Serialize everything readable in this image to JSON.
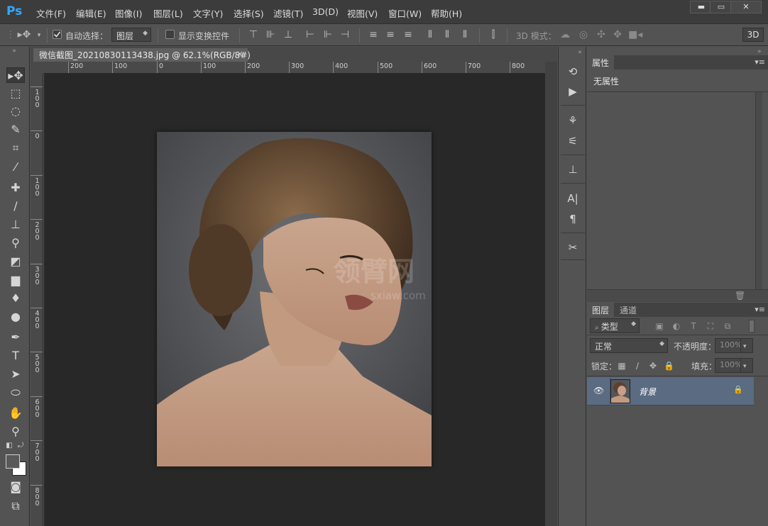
{
  "app": {
    "logo": "Ps"
  },
  "menu": [
    "文件(F)",
    "编辑(E)",
    "图像(I)",
    "图层(L)",
    "文字(Y)",
    "选择(S)",
    "滤镜(T)",
    "3D(D)",
    "视图(V)",
    "窗口(W)",
    "帮助(H)"
  ],
  "window_controls": {
    "minimize": "▬",
    "restore": "▭",
    "close": "✕"
  },
  "options": {
    "auto_select_label": "自动选择：",
    "auto_select_checked": true,
    "auto_select_target": "图层",
    "show_transform_label": "显示变换控件",
    "show_transform_checked": false,
    "mode_3d_label": "3D 模式：",
    "btn_3d": "3D"
  },
  "document": {
    "tab_title": "微信截图_20210830113438.jpg @ 62.1%(RGB/8#)",
    "tab_close": "×",
    "ruler_h_labels": [
      "200",
      "100",
      "0",
      "100",
      "200",
      "300",
      "400",
      "500",
      "600",
      "700",
      "800"
    ],
    "ruler_v_labels": [
      "100",
      "0",
      "100",
      "200",
      "300",
      "400",
      "500",
      "600",
      "700",
      "800"
    ],
    "watermark": "领臂网",
    "watermark_sub": "sxiaw.com"
  },
  "properties_panel": {
    "tab": "属性",
    "content": "无属性"
  },
  "layers_panel": {
    "tabs": [
      "图层",
      "通道"
    ],
    "filter_label": "类型",
    "blend_mode": "正常",
    "opacity_label": "不透明度：",
    "opacity_value": "100%",
    "lock_label": "锁定：",
    "fill_label": "填充：",
    "fill_value": "100%",
    "layers": [
      {
        "name": "背景",
        "visible": true,
        "locked": true
      }
    ]
  },
  "colors": {
    "menubar": "#3c3c3c",
    "panel": "#535353",
    "canvas": "#282828",
    "selected_layer": "#5a6b82",
    "accent_ps": "#31a8ff"
  }
}
